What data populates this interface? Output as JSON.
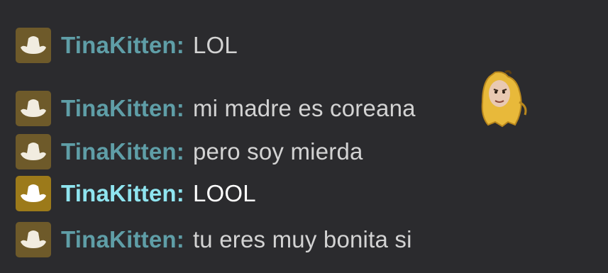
{
  "chat": {
    "messages": [
      {
        "username": "TinaKitten",
        "separator": ":",
        "text": "LOL",
        "highlighted": false
      },
      {
        "username": "TinaKitten",
        "separator": ":",
        "text": "mi madre es coreana",
        "highlighted": false,
        "emote": "smiling-banana-face-emote"
      },
      {
        "username": "TinaKitten",
        "separator": ":",
        "text": "pero soy mierda",
        "highlighted": false
      },
      {
        "username": "TinaKitten",
        "separator": ":",
        "text": "LOOL",
        "highlighted": true
      },
      {
        "username": "TinaKitten",
        "separator": ":",
        "text": "tu eres muy bonita si",
        "highlighted": false
      }
    ],
    "badge_icon": "cowboy-hat-icon"
  },
  "colors": {
    "background": "#2b2b2e",
    "username": "#5f9ea7",
    "username_highlight": "#8fe4ef",
    "message_text": "#d3d3d3",
    "message_text_highlight": "#ffffff",
    "badge": "#6e5a2a",
    "badge_highlight": "#9c7a1a"
  }
}
